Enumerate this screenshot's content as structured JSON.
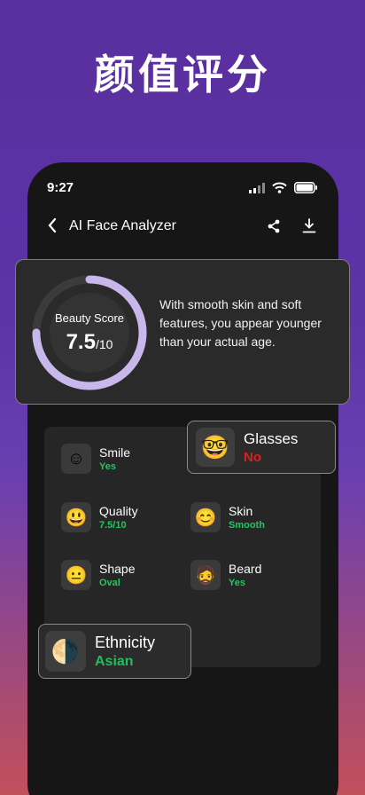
{
  "hero": {
    "title": "颜值评分"
  },
  "status_bar": {
    "time": "9:27"
  },
  "nav": {
    "back_icon": "chevron-left-icon",
    "title": "AI Face Analyzer",
    "share_icon": "share-icon",
    "download_icon": "download-icon"
  },
  "score": {
    "label": "Beauty Score",
    "value": "7.5",
    "max": "/10",
    "fraction": 0.75,
    "ring_color": "#c7b7ea",
    "description": "With smooth skin and soft features, you appear younger than your actual age."
  },
  "attributes": {
    "smile": {
      "name": "Smile",
      "value": "Yes",
      "icon": "☺"
    },
    "quality": {
      "name": "Quality",
      "value": "7.5/10",
      "icon": "😃"
    },
    "skin": {
      "name": "Skin",
      "value": "Smooth",
      "icon": "😊"
    },
    "shape": {
      "name": "Shape",
      "value": "Oval",
      "icon": "😐"
    },
    "beard": {
      "name": "Beard",
      "value": "Yes",
      "icon": "🧔"
    }
  },
  "glasses": {
    "name": "Glasses",
    "value": "No",
    "icon": "🤓",
    "value_color": "#dc2020"
  },
  "ethnicity": {
    "name": "Ethnicity",
    "value": "Asian",
    "icon": "🌗",
    "value_color": "#1fbf5a"
  },
  "colors": {
    "positive": "#22c55e",
    "negative": "#dc2020",
    "accent": "#c7b7ea"
  }
}
